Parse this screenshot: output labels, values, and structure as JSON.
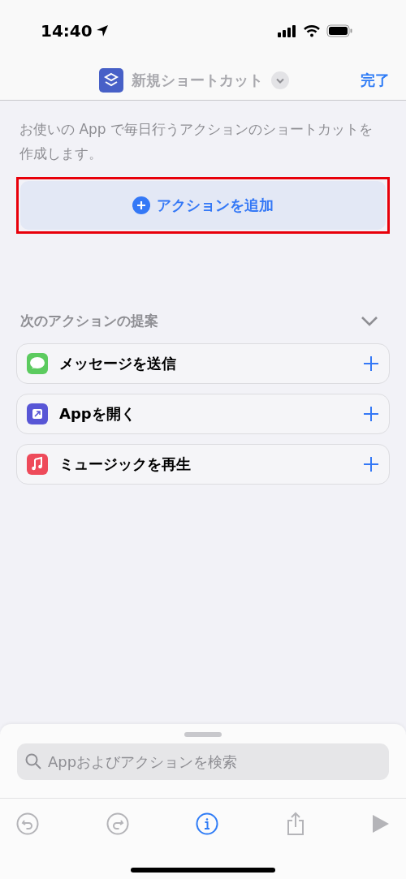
{
  "status_bar": {
    "time": "14:40"
  },
  "nav": {
    "title": "新規ショートカット",
    "done": "完了"
  },
  "description": "お使いの App で毎日行うアクションのショートカットを作成します。",
  "add_action": {
    "label": "アクションを追加",
    "highlighted": true
  },
  "suggestions": {
    "title": "次のアクションの提案",
    "expanded": true,
    "items": [
      {
        "kind": "messages",
        "label": "メッセージを送信"
      },
      {
        "kind": "open-app",
        "label": "Appを開く"
      },
      {
        "kind": "music",
        "label": "ミュージックを再生"
      }
    ]
  },
  "search": {
    "placeholder": "Appおよびアクションを検索"
  },
  "toolbar": [
    {
      "kind": "undo",
      "disabled": true
    },
    {
      "kind": "redo",
      "disabled": true
    },
    {
      "kind": "info",
      "disabled": false
    },
    {
      "kind": "share",
      "disabled": true
    },
    {
      "kind": "play",
      "disabled": true
    }
  ]
}
